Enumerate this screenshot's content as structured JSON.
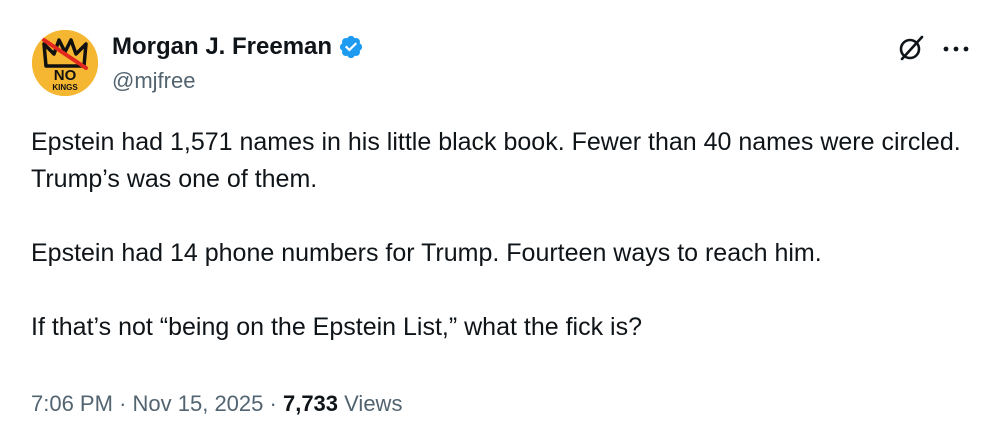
{
  "author": {
    "display_name": "Morgan J. Freeman",
    "handle": "@mjfree",
    "verified": true,
    "avatar": {
      "icon": "no-kings-crown-avatar",
      "line1": "NO",
      "line2": "KINGS",
      "background": "#f5b731",
      "strike_color": "#e0281f"
    }
  },
  "icons": {
    "grok": "grok-icon",
    "more": "more-icon",
    "verified": "verified-badge-icon"
  },
  "tweet": {
    "paragraphs": [
      "Epstein had 1,571 names in his little black book. Fewer than 40 names were circled. Trump’s was one of them.",
      "Epstein had 14 phone numbers for Trump. Fourteen ways to reach him.",
      "If that’s not “being on the Epstein List,” what the fick is?"
    ]
  },
  "meta": {
    "time": "7:06 PM",
    "separator": "·",
    "date": "Nov 15, 2025",
    "views_count": "7,733",
    "views_label": "Views"
  },
  "colors": {
    "text_primary": "#0f1419",
    "text_secondary": "#536471",
    "verified_blue": "#1d9bf0"
  }
}
